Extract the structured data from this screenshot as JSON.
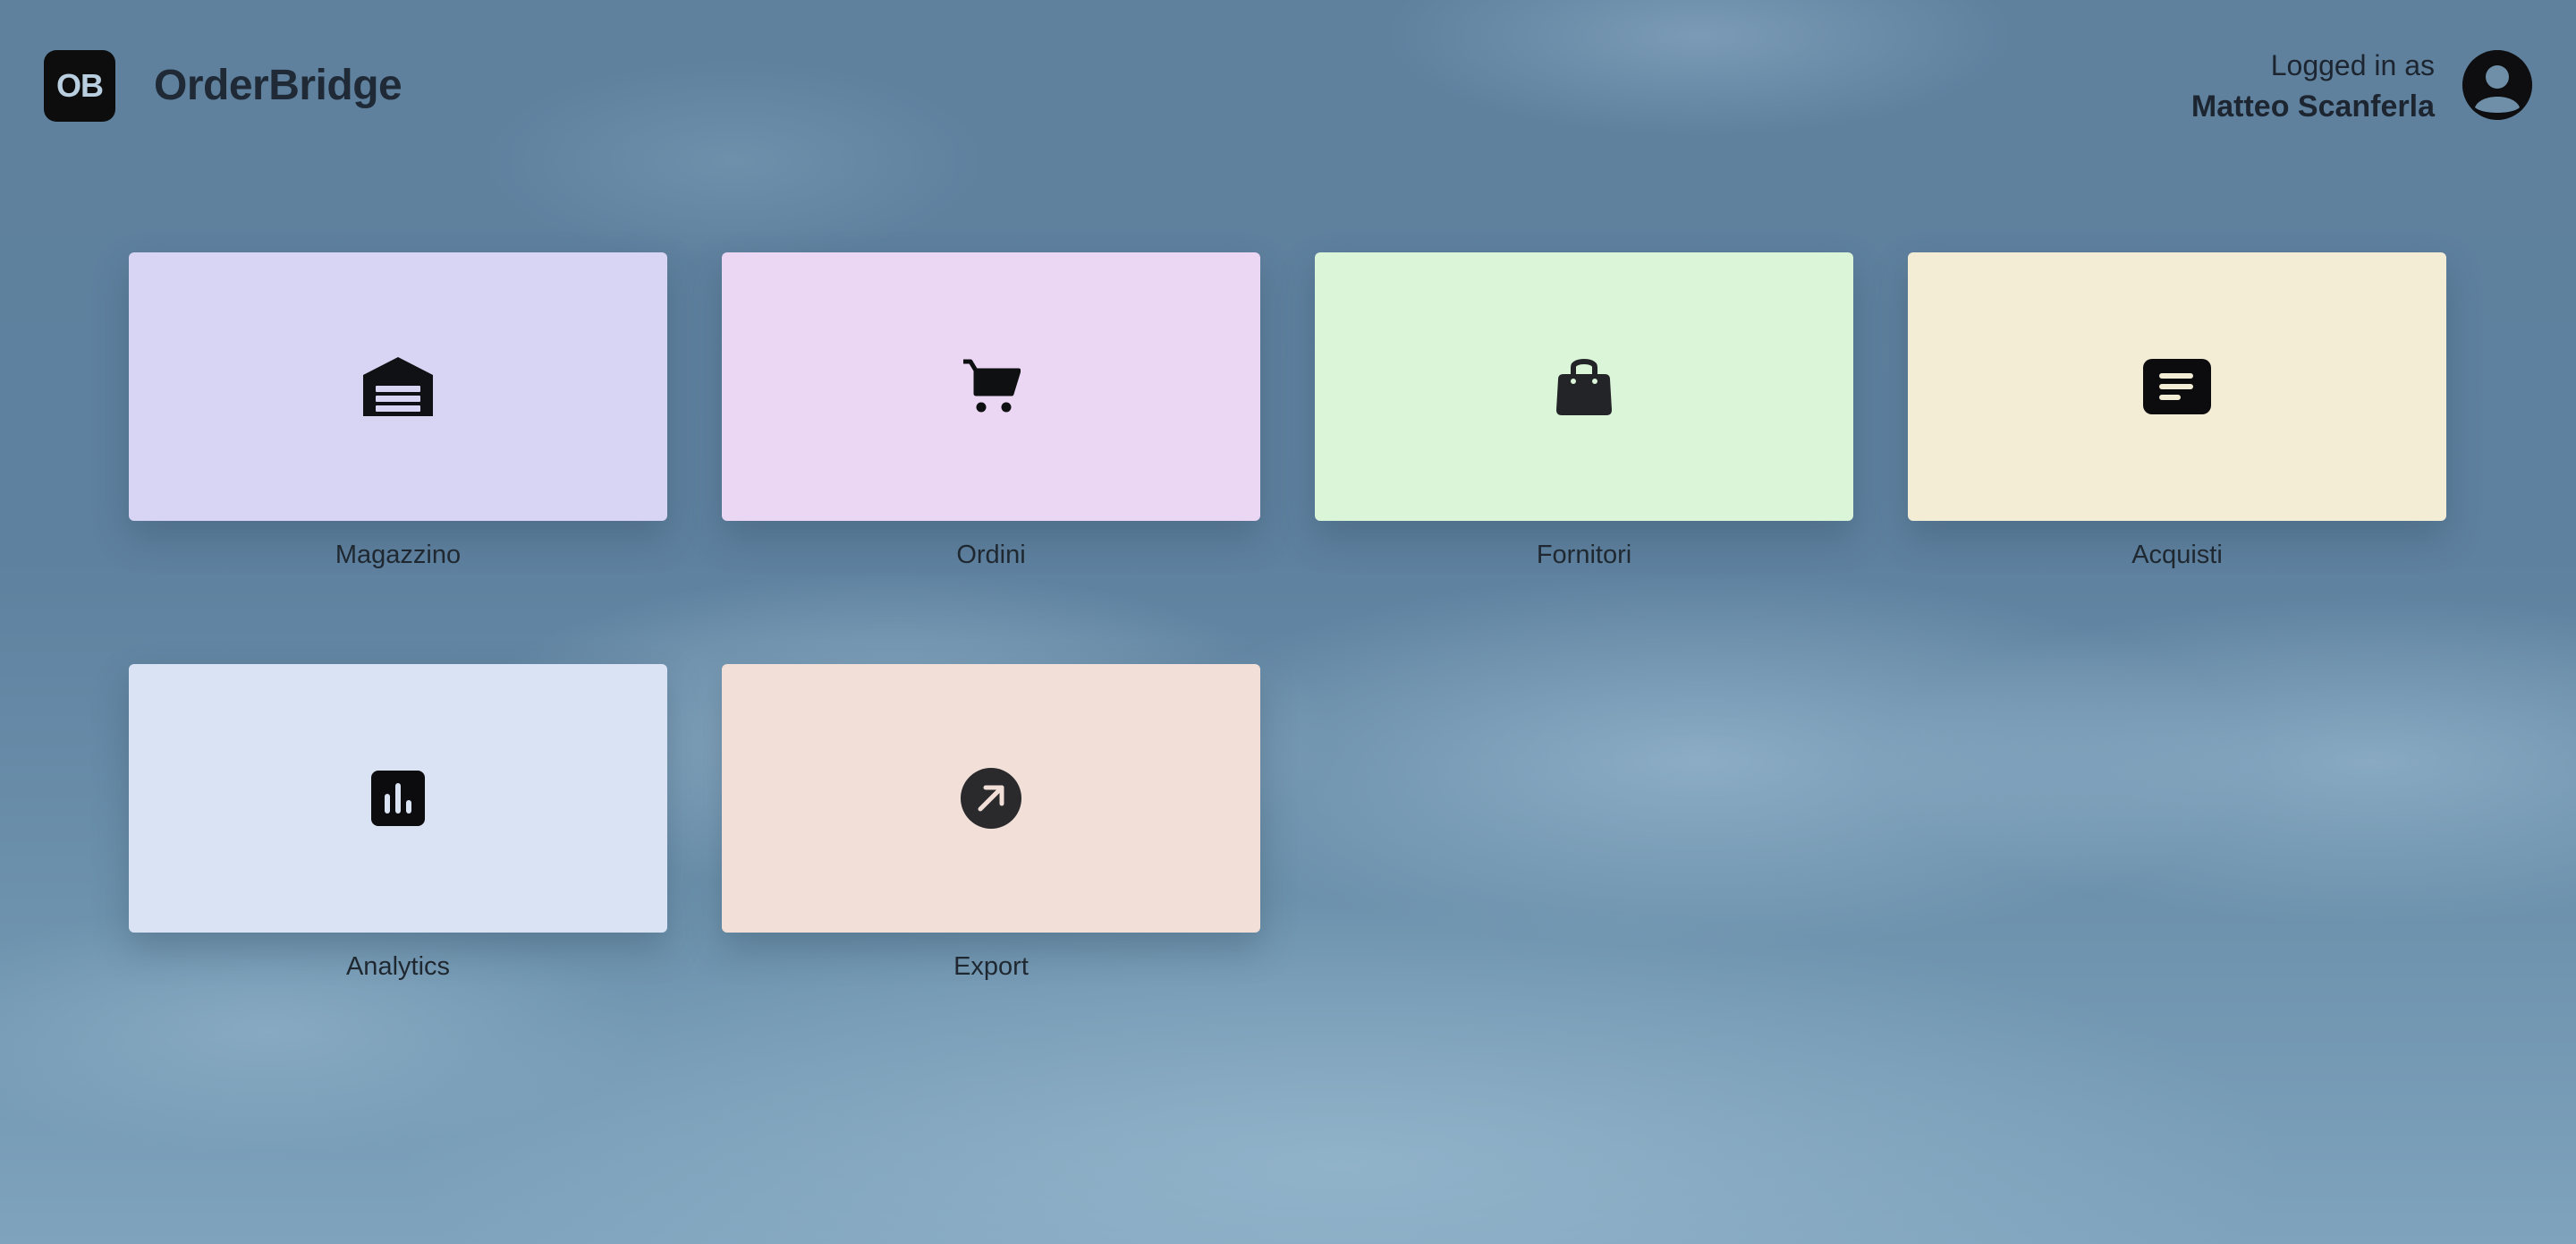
{
  "header": {
    "logo_text": "OB",
    "app_title": "OrderBridge",
    "user_caption": "Logged in as",
    "user_name": "Matteo Scanferla"
  },
  "tiles": [
    {
      "label": "Magazzino",
      "icon": "warehouse-icon",
      "color": "#d8d4f3"
    },
    {
      "label": "Ordini",
      "icon": "shopping-cart-icon",
      "color": "#ebd6f3"
    },
    {
      "label": "Fornitori",
      "icon": "shopping-bag-icon",
      "color": "#daf5d8"
    },
    {
      "label": "Acquisti",
      "icon": "receipt-icon",
      "color": "#f3edd6"
    },
    {
      "label": "Analytics",
      "icon": "bar-chart-icon",
      "color": "#d9e3f3"
    },
    {
      "label": "Export",
      "icon": "arrow-up-right-circle-icon",
      "color": "#f2e0d8"
    }
  ]
}
